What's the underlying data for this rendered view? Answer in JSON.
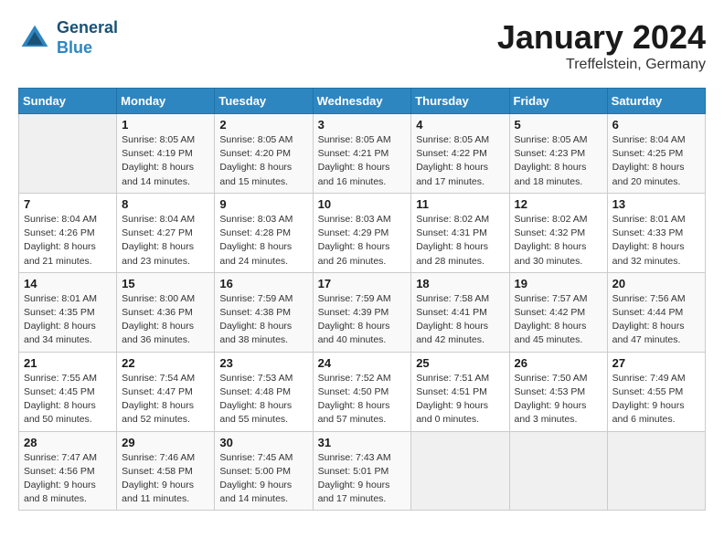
{
  "header": {
    "logo_line1": "General",
    "logo_line2": "Blue",
    "month": "January 2024",
    "location": "Treffelstein, Germany"
  },
  "days_of_week": [
    "Sunday",
    "Monday",
    "Tuesday",
    "Wednesday",
    "Thursday",
    "Friday",
    "Saturday"
  ],
  "weeks": [
    [
      {
        "day": "",
        "sunrise": "",
        "sunset": "",
        "daylight": ""
      },
      {
        "day": "1",
        "sunrise": "Sunrise: 8:05 AM",
        "sunset": "Sunset: 4:19 PM",
        "daylight": "Daylight: 8 hours and 14 minutes."
      },
      {
        "day": "2",
        "sunrise": "Sunrise: 8:05 AM",
        "sunset": "Sunset: 4:20 PM",
        "daylight": "Daylight: 8 hours and 15 minutes."
      },
      {
        "day": "3",
        "sunrise": "Sunrise: 8:05 AM",
        "sunset": "Sunset: 4:21 PM",
        "daylight": "Daylight: 8 hours and 16 minutes."
      },
      {
        "day": "4",
        "sunrise": "Sunrise: 8:05 AM",
        "sunset": "Sunset: 4:22 PM",
        "daylight": "Daylight: 8 hours and 17 minutes."
      },
      {
        "day": "5",
        "sunrise": "Sunrise: 8:05 AM",
        "sunset": "Sunset: 4:23 PM",
        "daylight": "Daylight: 8 hours and 18 minutes."
      },
      {
        "day": "6",
        "sunrise": "Sunrise: 8:04 AM",
        "sunset": "Sunset: 4:25 PM",
        "daylight": "Daylight: 8 hours and 20 minutes."
      }
    ],
    [
      {
        "day": "7",
        "sunrise": "Sunrise: 8:04 AM",
        "sunset": "Sunset: 4:26 PM",
        "daylight": "Daylight: 8 hours and 21 minutes."
      },
      {
        "day": "8",
        "sunrise": "Sunrise: 8:04 AM",
        "sunset": "Sunset: 4:27 PM",
        "daylight": "Daylight: 8 hours and 23 minutes."
      },
      {
        "day": "9",
        "sunrise": "Sunrise: 8:03 AM",
        "sunset": "Sunset: 4:28 PM",
        "daylight": "Daylight: 8 hours and 24 minutes."
      },
      {
        "day": "10",
        "sunrise": "Sunrise: 8:03 AM",
        "sunset": "Sunset: 4:29 PM",
        "daylight": "Daylight: 8 hours and 26 minutes."
      },
      {
        "day": "11",
        "sunrise": "Sunrise: 8:02 AM",
        "sunset": "Sunset: 4:31 PM",
        "daylight": "Daylight: 8 hours and 28 minutes."
      },
      {
        "day": "12",
        "sunrise": "Sunrise: 8:02 AM",
        "sunset": "Sunset: 4:32 PM",
        "daylight": "Daylight: 8 hours and 30 minutes."
      },
      {
        "day": "13",
        "sunrise": "Sunrise: 8:01 AM",
        "sunset": "Sunset: 4:33 PM",
        "daylight": "Daylight: 8 hours and 32 minutes."
      }
    ],
    [
      {
        "day": "14",
        "sunrise": "Sunrise: 8:01 AM",
        "sunset": "Sunset: 4:35 PM",
        "daylight": "Daylight: 8 hours and 34 minutes."
      },
      {
        "day": "15",
        "sunrise": "Sunrise: 8:00 AM",
        "sunset": "Sunset: 4:36 PM",
        "daylight": "Daylight: 8 hours and 36 minutes."
      },
      {
        "day": "16",
        "sunrise": "Sunrise: 7:59 AM",
        "sunset": "Sunset: 4:38 PM",
        "daylight": "Daylight: 8 hours and 38 minutes."
      },
      {
        "day": "17",
        "sunrise": "Sunrise: 7:59 AM",
        "sunset": "Sunset: 4:39 PM",
        "daylight": "Daylight: 8 hours and 40 minutes."
      },
      {
        "day": "18",
        "sunrise": "Sunrise: 7:58 AM",
        "sunset": "Sunset: 4:41 PM",
        "daylight": "Daylight: 8 hours and 42 minutes."
      },
      {
        "day": "19",
        "sunrise": "Sunrise: 7:57 AM",
        "sunset": "Sunset: 4:42 PM",
        "daylight": "Daylight: 8 hours and 45 minutes."
      },
      {
        "day": "20",
        "sunrise": "Sunrise: 7:56 AM",
        "sunset": "Sunset: 4:44 PM",
        "daylight": "Daylight: 8 hours and 47 minutes."
      }
    ],
    [
      {
        "day": "21",
        "sunrise": "Sunrise: 7:55 AM",
        "sunset": "Sunset: 4:45 PM",
        "daylight": "Daylight: 8 hours and 50 minutes."
      },
      {
        "day": "22",
        "sunrise": "Sunrise: 7:54 AM",
        "sunset": "Sunset: 4:47 PM",
        "daylight": "Daylight: 8 hours and 52 minutes."
      },
      {
        "day": "23",
        "sunrise": "Sunrise: 7:53 AM",
        "sunset": "Sunset: 4:48 PM",
        "daylight": "Daylight: 8 hours and 55 minutes."
      },
      {
        "day": "24",
        "sunrise": "Sunrise: 7:52 AM",
        "sunset": "Sunset: 4:50 PM",
        "daylight": "Daylight: 8 hours and 57 minutes."
      },
      {
        "day": "25",
        "sunrise": "Sunrise: 7:51 AM",
        "sunset": "Sunset: 4:51 PM",
        "daylight": "Daylight: 9 hours and 0 minutes."
      },
      {
        "day": "26",
        "sunrise": "Sunrise: 7:50 AM",
        "sunset": "Sunset: 4:53 PM",
        "daylight": "Daylight: 9 hours and 3 minutes."
      },
      {
        "day": "27",
        "sunrise": "Sunrise: 7:49 AM",
        "sunset": "Sunset: 4:55 PM",
        "daylight": "Daylight: 9 hours and 6 minutes."
      }
    ],
    [
      {
        "day": "28",
        "sunrise": "Sunrise: 7:47 AM",
        "sunset": "Sunset: 4:56 PM",
        "daylight": "Daylight: 9 hours and 8 minutes."
      },
      {
        "day": "29",
        "sunrise": "Sunrise: 7:46 AM",
        "sunset": "Sunset: 4:58 PM",
        "daylight": "Daylight: 9 hours and 11 minutes."
      },
      {
        "day": "30",
        "sunrise": "Sunrise: 7:45 AM",
        "sunset": "Sunset: 5:00 PM",
        "daylight": "Daylight: 9 hours and 14 minutes."
      },
      {
        "day": "31",
        "sunrise": "Sunrise: 7:43 AM",
        "sunset": "Sunset: 5:01 PM",
        "daylight": "Daylight: 9 hours and 17 minutes."
      },
      {
        "day": "",
        "sunrise": "",
        "sunset": "",
        "daylight": ""
      },
      {
        "day": "",
        "sunrise": "",
        "sunset": "",
        "daylight": ""
      },
      {
        "day": "",
        "sunrise": "",
        "sunset": "",
        "daylight": ""
      }
    ]
  ]
}
